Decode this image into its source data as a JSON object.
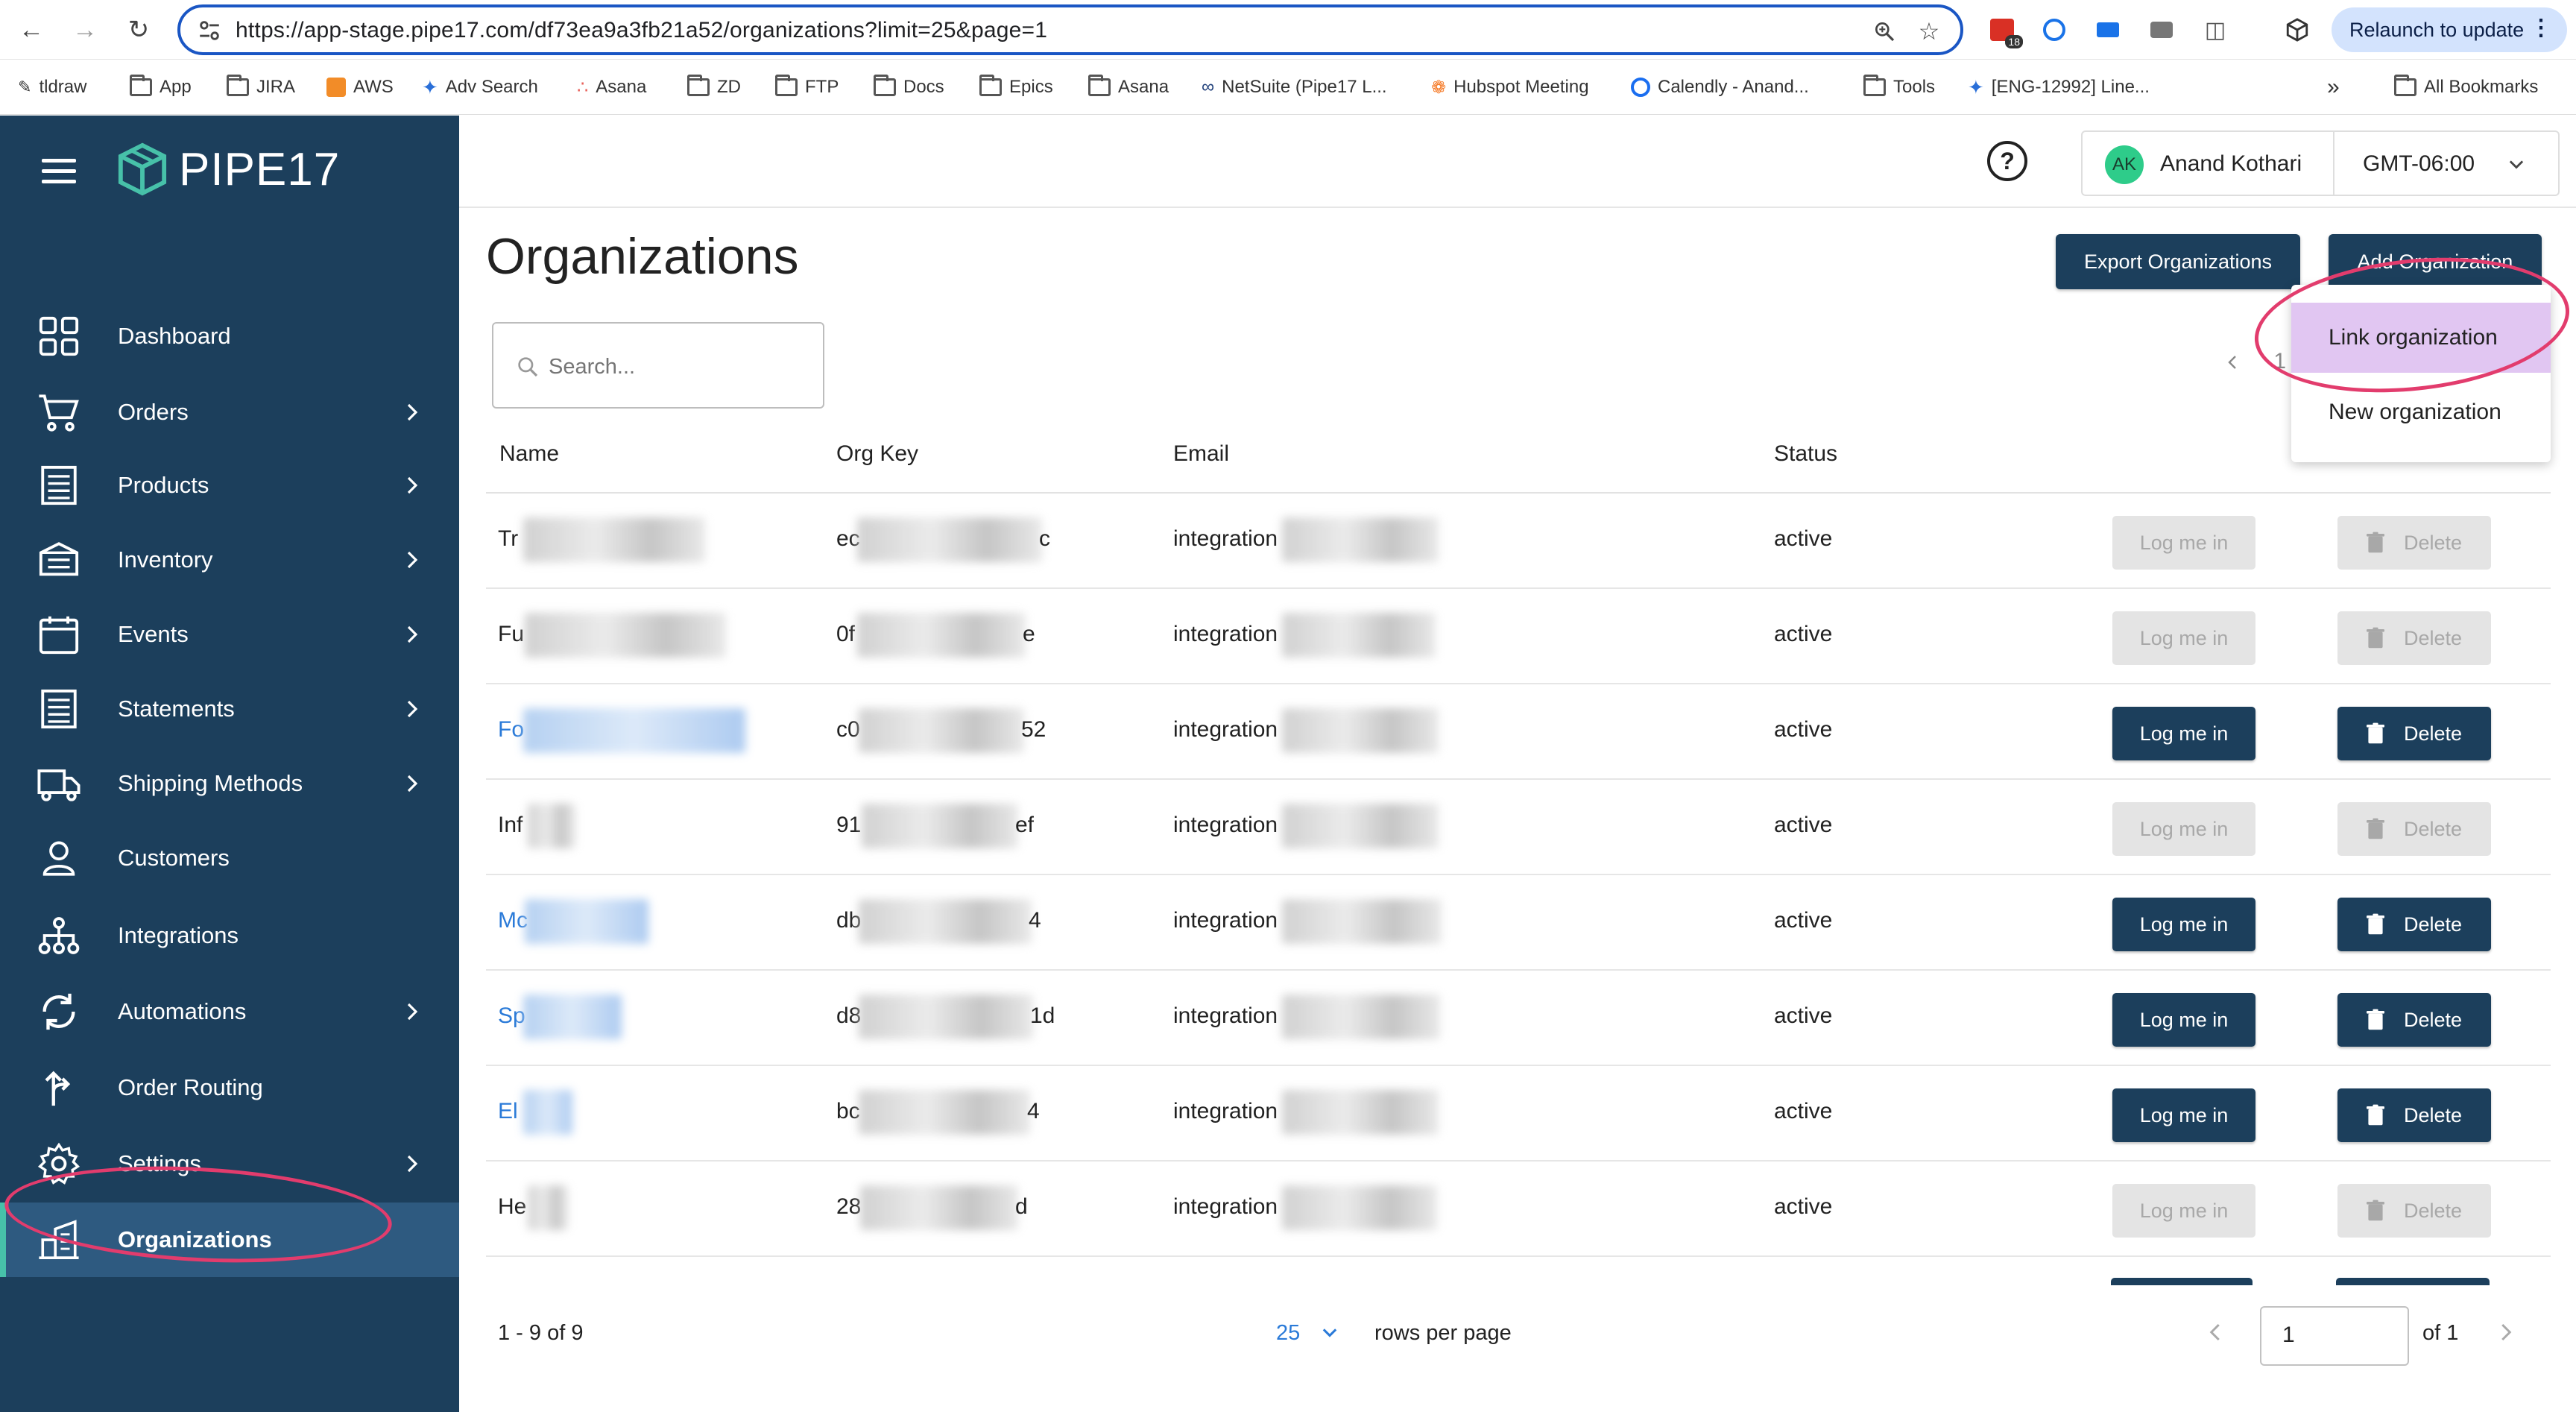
{
  "browser": {
    "url": "https://app-stage.pipe17.com/df73ea9a3fb21a52/organizations?limit=25&page=1",
    "relaunch_label": "Relaunch to update",
    "calendar_badge": "18",
    "bookmarks": [
      "tldraw",
      "App",
      "JIRA",
      "AWS",
      "Adv Search",
      "Asana",
      "ZD",
      "FTP",
      "Docs",
      "Epics",
      "Asana",
      "NetSuite (Pipe17 L...",
      "Hubspot Meeting",
      "Calendly - Anand...",
      "Tools",
      "[ENG-12992] Line...",
      "All Bookmarks"
    ],
    "more_bookmarks": "»"
  },
  "app": {
    "logo_text": "PIPE17",
    "brand_color": "#1c3f5c",
    "accent_color": "#47c1a9"
  },
  "sidebar": {
    "items": [
      {
        "label": "Dashboard",
        "icon": "dashboard-grid-icon"
      },
      {
        "label": "Orders",
        "icon": "cart-icon"
      },
      {
        "label": "Products",
        "icon": "products-icon"
      },
      {
        "label": "Inventory",
        "icon": "inventory-icon"
      },
      {
        "label": "Events",
        "icon": "calendar-icon"
      },
      {
        "label": "Statements",
        "icon": "statement-icon"
      },
      {
        "label": "Shipping Methods",
        "icon": "truck-icon"
      },
      {
        "label": "Customers",
        "icon": "person-icon"
      },
      {
        "label": "Integrations",
        "icon": "network-icon"
      },
      {
        "label": "Automations",
        "icon": "sync-icon"
      },
      {
        "label": "Order Routing",
        "icon": "routing-icon"
      },
      {
        "label": "Settings",
        "icon": "gear-icon"
      },
      {
        "label": "Organizations",
        "icon": "building-icon"
      }
    ]
  },
  "header": {
    "user_initials": "AK",
    "user_name": "Anand Kothari",
    "timezone": "GMT-06:00"
  },
  "page": {
    "title": "Organizations",
    "export_label": "Export Organizations",
    "add_label": "Add Organization",
    "search_placeholder": "Search...",
    "pager_top": "1",
    "columns": {
      "name": "Name",
      "org_key": "Org Key",
      "email": "Email",
      "status": "Status"
    },
    "rows": [
      {
        "name": "Tr",
        "key_pre": "ec",
        "key_post": "c",
        "email": "integration",
        "status": "active",
        "enabled": false,
        "login": "Log me in",
        "delete": "Delete"
      },
      {
        "name": "Fu",
        "key_pre": "0f",
        "key_post": "e",
        "email": "integration",
        "status": "active",
        "enabled": false,
        "login": "Log me in",
        "delete": "Delete"
      },
      {
        "name": "Fo",
        "key_pre": "c0",
        "key_post": "52",
        "email": "integration",
        "status": "active",
        "enabled": true,
        "login": "Log me in",
        "delete": "Delete"
      },
      {
        "name": "Inf",
        "key_pre": "91",
        "key_post": "ef",
        "email": "integration",
        "status": "active",
        "enabled": false,
        "login": "Log me in",
        "delete": "Delete"
      },
      {
        "name": "Mc",
        "key_pre": "db",
        "key_post": "4",
        "email": "integration",
        "status": "active",
        "enabled": true,
        "login": "Log me in",
        "delete": "Delete"
      },
      {
        "name": "Sp",
        "key_pre": "d8",
        "key_post": "1d",
        "email": "integration",
        "status": "active",
        "enabled": true,
        "login": "Log me in",
        "delete": "Delete"
      },
      {
        "name": "El",
        "key_pre": "bc",
        "key_post": "4",
        "email": "integration",
        "status": "active",
        "enabled": true,
        "login": "Log me in",
        "delete": "Delete"
      },
      {
        "name": "He",
        "key_pre": "28",
        "key_post": "d",
        "email": "integration",
        "status": "active",
        "enabled": false,
        "login": "Log me in",
        "delete": "Delete"
      }
    ],
    "footer": {
      "count": "1 - 9 of 9",
      "rows_per_page_value": "25",
      "rows_per_page_label": "rows per page",
      "page_value": "1",
      "of_pages": "of 1"
    }
  },
  "dropdown": {
    "items": [
      {
        "label": "Link organization",
        "highlighted": true
      },
      {
        "label": "New organization",
        "highlighted": false
      }
    ],
    "highlight_color": "#e1c6f2"
  },
  "annotation_color": "#e23c6d"
}
